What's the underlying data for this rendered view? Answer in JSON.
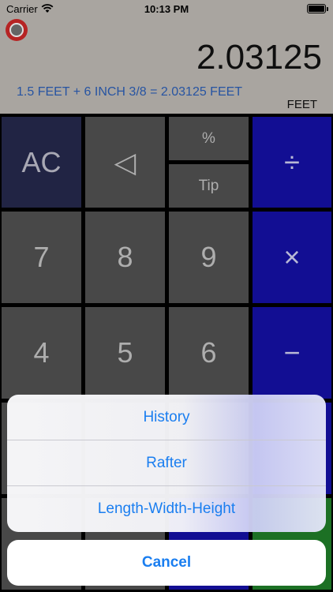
{
  "status_bar": {
    "carrier": "Carrier",
    "time": "10:13 PM",
    "battery_level": 1.0
  },
  "display": {
    "result": "2.03125",
    "expression": "1.5 FEET + 6 INCH 3/8 = 2.03125 FEET",
    "unit": "FEET"
  },
  "keys": {
    "ac": "AC",
    "backspace": "◁",
    "percent": "%",
    "tip": "Tip",
    "divide": "÷",
    "seven": "7",
    "eight": "8",
    "nine": "9",
    "multiply": "×",
    "four": "4",
    "five": "5",
    "six": "6",
    "minus": "−"
  },
  "action_sheet": {
    "items": [
      "History",
      "Rafter",
      "Length-Width-Height"
    ],
    "cancel": "Cancel"
  },
  "colors": {
    "display_bg": "#b8b4ae",
    "key_gray": "#4f4f4f",
    "key_ac": "#24284a",
    "key_operator": "#1410a0",
    "link_blue": "#1a7ef0",
    "expression_blue": "#2b5cb0"
  },
  "icons": {
    "wifi": "wifi-icon",
    "battery": "battery-icon",
    "record": "record-icon"
  }
}
